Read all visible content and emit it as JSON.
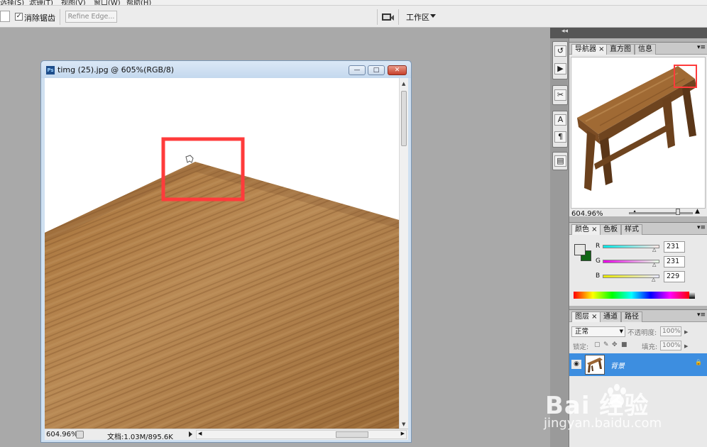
{
  "menu": {
    "items": [
      "选择(S)",
      "滤镜(T)",
      "视图(V)",
      "窗口(W)",
      "帮助(H)"
    ]
  },
  "options_bar": {
    "antialias_label": "消除锯齿",
    "antialias_check": "✓",
    "refine_edge_label": "Refine Edge...",
    "workspace_label": "工作区"
  },
  "document": {
    "title": "timg (25).jpg @ 605%(RGB/8)",
    "ps_icon": "Ps",
    "minimize": "—",
    "maximize": "□",
    "close": "✕",
    "zoom": "604.96%",
    "doc_info": "文档:1.03M/895.6K"
  },
  "navigator": {
    "tabs": [
      "导航器 ×",
      "直方图",
      "信息"
    ],
    "zoom": "604.96%"
  },
  "color_panel": {
    "tabs": [
      "颜色 ×",
      "色板",
      "样式"
    ],
    "channels": [
      {
        "label": "R",
        "value": "231",
        "fill": 0.906
      },
      {
        "label": "G",
        "value": "231",
        "fill": 0.906
      },
      {
        "label": "B",
        "value": "229",
        "fill": 0.898
      }
    ],
    "foreground": "#e7e7e5",
    "background": "#116615"
  },
  "layers_panel": {
    "tabs": [
      "图层 ×",
      "通道",
      "路径"
    ],
    "blend_mode": "正常",
    "opacity_label": "不透明度:",
    "opacity_value": "100%",
    "lock_label": "锁定:",
    "fill_label": "填充:",
    "fill_value": "100%",
    "layer_name": "背景"
  },
  "watermark": {
    "brand": "Bai 经验",
    "site": "jingyan.baidu.com"
  },
  "colors": {
    "accent_red": "#ff3b3b",
    "layer_selected": "#3d8ee0"
  }
}
